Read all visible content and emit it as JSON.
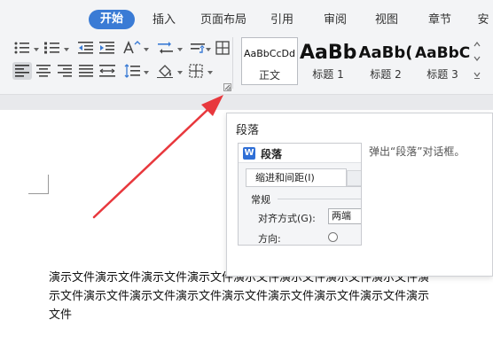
{
  "ribbon": {
    "tabs": [
      "开始",
      "插入",
      "页面布局",
      "引用",
      "审阅",
      "视图",
      "章节",
      "安"
    ],
    "active_tab": "开始",
    "styles": [
      {
        "sample": "AaBbCcDd",
        "label": "正文"
      },
      {
        "sample": "AaBb",
        "label": "标题 1"
      },
      {
        "sample": "AaBb(",
        "label": "标题 2"
      },
      {
        "sample": "AaBbC",
        "label": "标题 3"
      }
    ]
  },
  "tooltip": {
    "title": "段落",
    "description": "弹出“段落”对话框。",
    "preview": {
      "dialog_title": "段落",
      "logo_letter": "W",
      "tab_label": "缩进和间距(I)",
      "section_label": "常规",
      "alignment_label": "对齐方式(G):",
      "alignment_value": "两端",
      "direction_label": "方向:"
    }
  },
  "document": {
    "paragraph": "演示文件演示文件演示文件演示文件演示文件演示文件演示文件演示文件演示文件演示文件演示文件演示文件演示文件演示文件演示文件演示文件演示文件"
  },
  "colors": {
    "accent": "#3a7bd5",
    "arrow": "#e8383d",
    "ribbon_bg": "#f3f4f6"
  }
}
